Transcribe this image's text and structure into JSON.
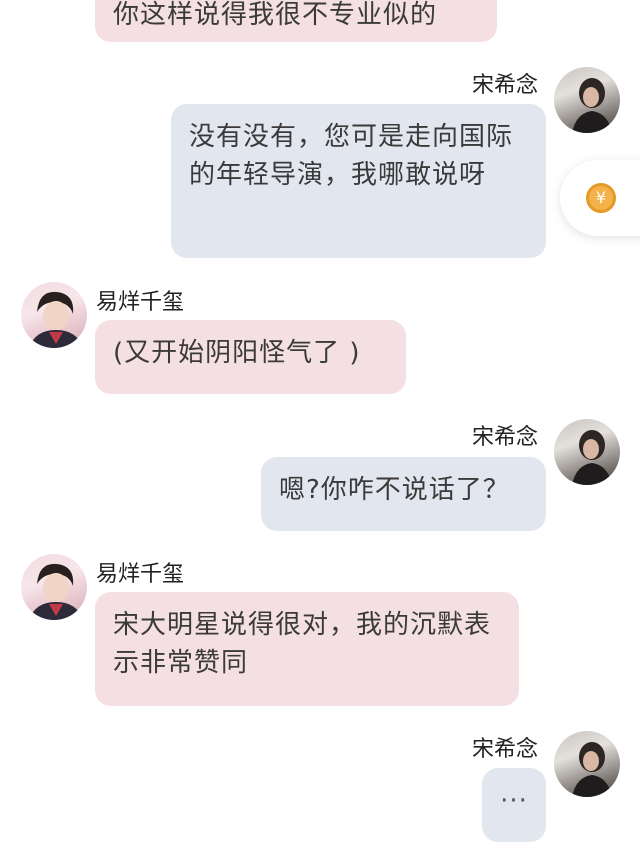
{
  "chat": {
    "messages": [
      {
        "side": "left",
        "text": "你这样说得我很不专业似的"
      },
      {
        "side": "right",
        "sender": "宋希念",
        "text": "没有没有，您可是走向国际的年轻导演，我哪敢说呀"
      },
      {
        "side": "left",
        "sender": "易烊千玺",
        "text": "(又开始阴阳怪气了 )"
      },
      {
        "side": "right",
        "sender": "宋希念",
        "text": "嗯?你咋不说话了？"
      },
      {
        "side": "left",
        "sender": "易烊千玺",
        "text": "宋大明星说得很对，我的沉默表示非常赞同"
      },
      {
        "side": "right",
        "sender": "宋希念",
        "text": "···"
      }
    ]
  },
  "float_button": {
    "icon": "coin-icon",
    "symbol": "¥"
  },
  "colors": {
    "left_bubble": "#f4dfe2",
    "right_bubble": "#e2e7ef",
    "accent": "#f4b24a"
  }
}
